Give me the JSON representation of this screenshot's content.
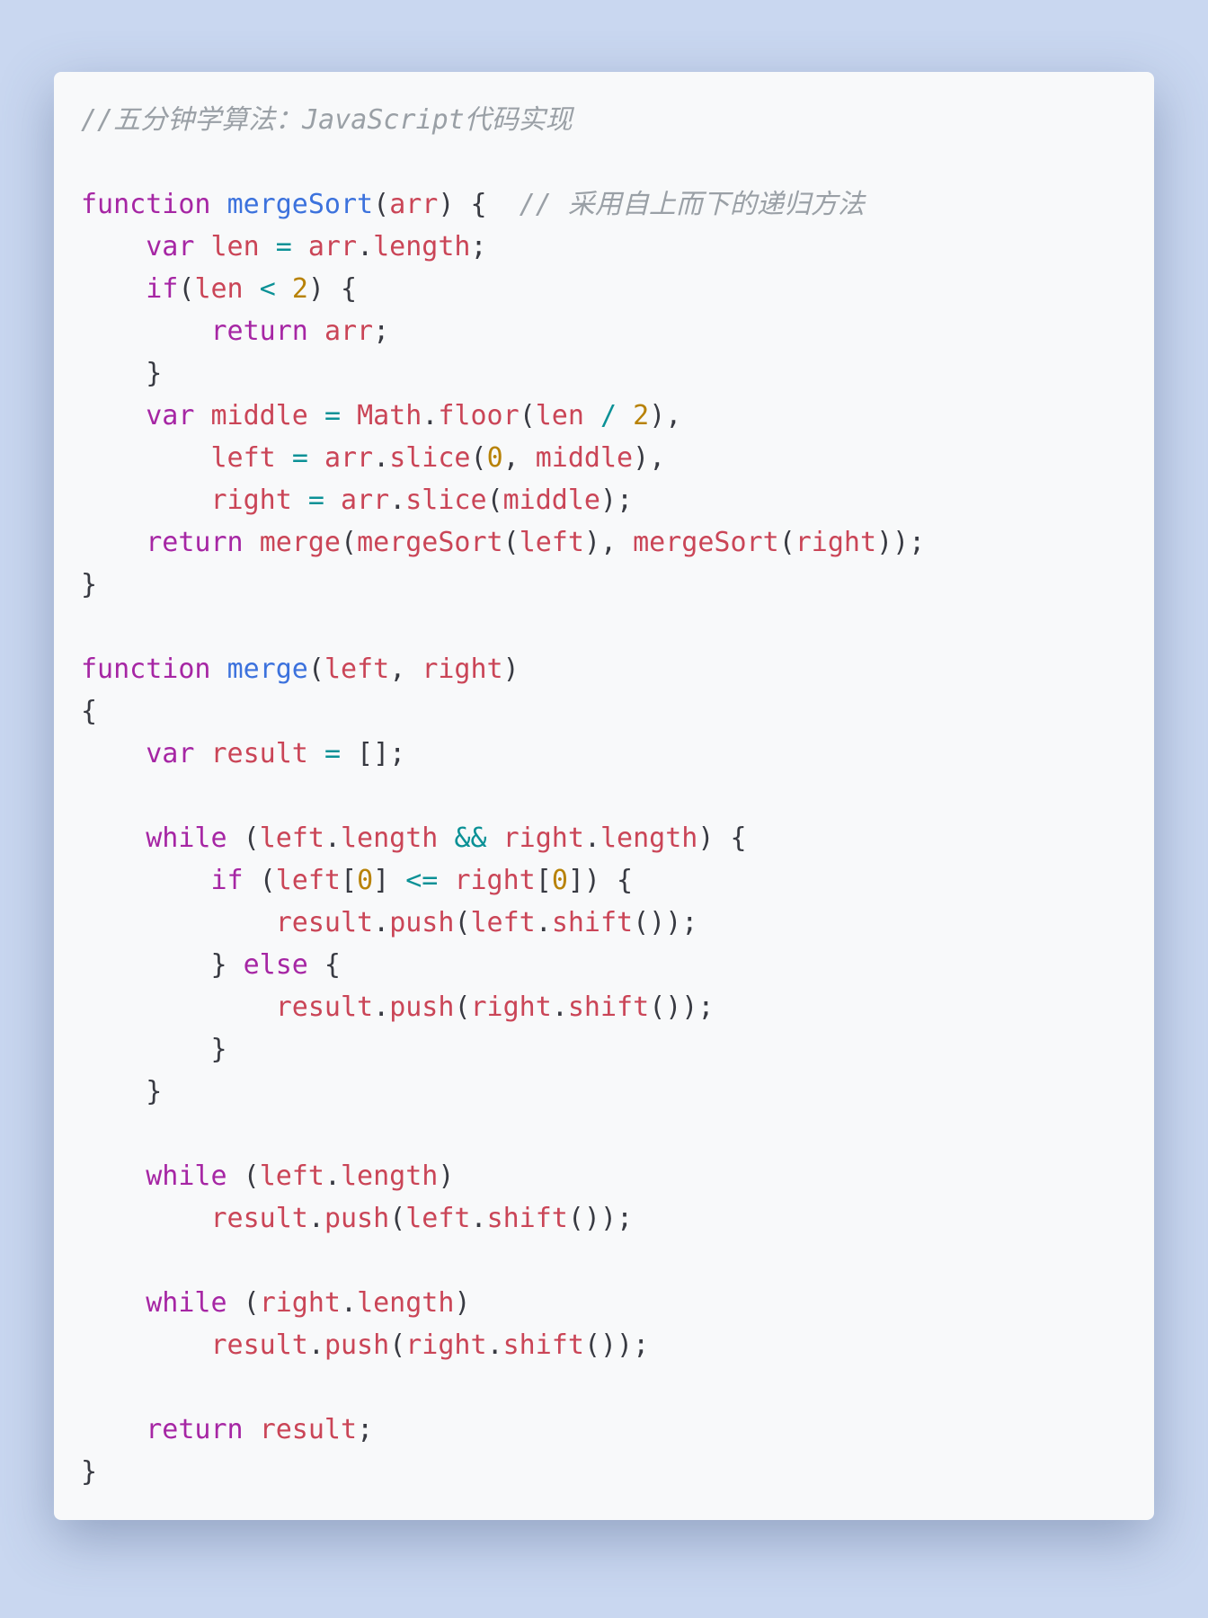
{
  "code": {
    "lines": [
      [
        {
          "t": "//五分钟学算法：JavaScript代码实现",
          "c": "tok-cm"
        }
      ],
      [
        {
          "t": "",
          "c": "tok-pl"
        }
      ],
      [
        {
          "t": "function",
          "c": "tok-kw"
        },
        {
          "t": " ",
          "c": "tok-pl"
        },
        {
          "t": "mergeSort",
          "c": "tok-fn"
        },
        {
          "t": "(",
          "c": "tok-pn"
        },
        {
          "t": "arr",
          "c": "tok-id"
        },
        {
          "t": ") {",
          "c": "tok-pn"
        },
        {
          "t": "  ",
          "c": "tok-pl"
        },
        {
          "t": "// 采用自上而下的递归方法",
          "c": "tok-cm"
        }
      ],
      [
        {
          "t": "    ",
          "c": "tok-pl"
        },
        {
          "t": "var",
          "c": "tok-kw"
        },
        {
          "t": " ",
          "c": "tok-pl"
        },
        {
          "t": "len",
          "c": "tok-id"
        },
        {
          "t": " ",
          "c": "tok-pl"
        },
        {
          "t": "=",
          "c": "tok-op"
        },
        {
          "t": " ",
          "c": "tok-pl"
        },
        {
          "t": "arr",
          "c": "tok-id"
        },
        {
          "t": ".",
          "c": "tok-pn"
        },
        {
          "t": "length",
          "c": "tok-id"
        },
        {
          "t": ";",
          "c": "tok-pn"
        }
      ],
      [
        {
          "t": "    ",
          "c": "tok-pl"
        },
        {
          "t": "if",
          "c": "tok-kw"
        },
        {
          "t": "(",
          "c": "tok-pn"
        },
        {
          "t": "len",
          "c": "tok-id"
        },
        {
          "t": " ",
          "c": "tok-pl"
        },
        {
          "t": "<",
          "c": "tok-op"
        },
        {
          "t": " ",
          "c": "tok-pl"
        },
        {
          "t": "2",
          "c": "tok-nm"
        },
        {
          "t": ") {",
          "c": "tok-pn"
        }
      ],
      [
        {
          "t": "        ",
          "c": "tok-pl"
        },
        {
          "t": "return",
          "c": "tok-kw"
        },
        {
          "t": " ",
          "c": "tok-pl"
        },
        {
          "t": "arr",
          "c": "tok-id"
        },
        {
          "t": ";",
          "c": "tok-pn"
        }
      ],
      [
        {
          "t": "    }",
          "c": "tok-pn"
        }
      ],
      [
        {
          "t": "    ",
          "c": "tok-pl"
        },
        {
          "t": "var",
          "c": "tok-kw"
        },
        {
          "t": " ",
          "c": "tok-pl"
        },
        {
          "t": "middle",
          "c": "tok-id"
        },
        {
          "t": " ",
          "c": "tok-pl"
        },
        {
          "t": "=",
          "c": "tok-op"
        },
        {
          "t": " ",
          "c": "tok-pl"
        },
        {
          "t": "Math",
          "c": "tok-id"
        },
        {
          "t": ".",
          "c": "tok-pn"
        },
        {
          "t": "floor",
          "c": "tok-id"
        },
        {
          "t": "(",
          "c": "tok-pn"
        },
        {
          "t": "len",
          "c": "tok-id"
        },
        {
          "t": " ",
          "c": "tok-pl"
        },
        {
          "t": "/",
          "c": "tok-op"
        },
        {
          "t": " ",
          "c": "tok-pl"
        },
        {
          "t": "2",
          "c": "tok-nm"
        },
        {
          "t": "),",
          "c": "tok-pn"
        }
      ],
      [
        {
          "t": "        ",
          "c": "tok-pl"
        },
        {
          "t": "left",
          "c": "tok-id"
        },
        {
          "t": " ",
          "c": "tok-pl"
        },
        {
          "t": "=",
          "c": "tok-op"
        },
        {
          "t": " ",
          "c": "tok-pl"
        },
        {
          "t": "arr",
          "c": "tok-id"
        },
        {
          "t": ".",
          "c": "tok-pn"
        },
        {
          "t": "slice",
          "c": "tok-id"
        },
        {
          "t": "(",
          "c": "tok-pn"
        },
        {
          "t": "0",
          "c": "tok-nm"
        },
        {
          "t": ", ",
          "c": "tok-pn"
        },
        {
          "t": "middle",
          "c": "tok-id"
        },
        {
          "t": "),",
          "c": "tok-pn"
        }
      ],
      [
        {
          "t": "        ",
          "c": "tok-pl"
        },
        {
          "t": "right",
          "c": "tok-id"
        },
        {
          "t": " ",
          "c": "tok-pl"
        },
        {
          "t": "=",
          "c": "tok-op"
        },
        {
          "t": " ",
          "c": "tok-pl"
        },
        {
          "t": "arr",
          "c": "tok-id"
        },
        {
          "t": ".",
          "c": "tok-pn"
        },
        {
          "t": "slice",
          "c": "tok-id"
        },
        {
          "t": "(",
          "c": "tok-pn"
        },
        {
          "t": "middle",
          "c": "tok-id"
        },
        {
          "t": ");",
          "c": "tok-pn"
        }
      ],
      [
        {
          "t": "    ",
          "c": "tok-pl"
        },
        {
          "t": "return",
          "c": "tok-kw"
        },
        {
          "t": " ",
          "c": "tok-pl"
        },
        {
          "t": "merge",
          "c": "tok-id"
        },
        {
          "t": "(",
          "c": "tok-pn"
        },
        {
          "t": "mergeSort",
          "c": "tok-id"
        },
        {
          "t": "(",
          "c": "tok-pn"
        },
        {
          "t": "left",
          "c": "tok-id"
        },
        {
          "t": "), ",
          "c": "tok-pn"
        },
        {
          "t": "mergeSort",
          "c": "tok-id"
        },
        {
          "t": "(",
          "c": "tok-pn"
        },
        {
          "t": "right",
          "c": "tok-id"
        },
        {
          "t": "));",
          "c": "tok-pn"
        }
      ],
      [
        {
          "t": "}",
          "c": "tok-pn"
        }
      ],
      [
        {
          "t": "",
          "c": "tok-pl"
        }
      ],
      [
        {
          "t": "function",
          "c": "tok-kw"
        },
        {
          "t": " ",
          "c": "tok-pl"
        },
        {
          "t": "merge",
          "c": "tok-fn"
        },
        {
          "t": "(",
          "c": "tok-pn"
        },
        {
          "t": "left",
          "c": "tok-id"
        },
        {
          "t": ", ",
          "c": "tok-pn"
        },
        {
          "t": "right",
          "c": "tok-id"
        },
        {
          "t": ")",
          "c": "tok-pn"
        }
      ],
      [
        {
          "t": "{",
          "c": "tok-pn"
        }
      ],
      [
        {
          "t": "    ",
          "c": "tok-pl"
        },
        {
          "t": "var",
          "c": "tok-kw"
        },
        {
          "t": " ",
          "c": "tok-pl"
        },
        {
          "t": "result",
          "c": "tok-id"
        },
        {
          "t": " ",
          "c": "tok-pl"
        },
        {
          "t": "=",
          "c": "tok-op"
        },
        {
          "t": " [];",
          "c": "tok-pn"
        }
      ],
      [
        {
          "t": "",
          "c": "tok-pl"
        }
      ],
      [
        {
          "t": "    ",
          "c": "tok-pl"
        },
        {
          "t": "while",
          "c": "tok-kw"
        },
        {
          "t": " (",
          "c": "tok-pn"
        },
        {
          "t": "left",
          "c": "tok-id"
        },
        {
          "t": ".",
          "c": "tok-pn"
        },
        {
          "t": "length",
          "c": "tok-id"
        },
        {
          "t": " ",
          "c": "tok-pl"
        },
        {
          "t": "&&",
          "c": "tok-op"
        },
        {
          "t": " ",
          "c": "tok-pl"
        },
        {
          "t": "right",
          "c": "tok-id"
        },
        {
          "t": ".",
          "c": "tok-pn"
        },
        {
          "t": "length",
          "c": "tok-id"
        },
        {
          "t": ") {",
          "c": "tok-pn"
        }
      ],
      [
        {
          "t": "        ",
          "c": "tok-pl"
        },
        {
          "t": "if",
          "c": "tok-kw"
        },
        {
          "t": " (",
          "c": "tok-pn"
        },
        {
          "t": "left",
          "c": "tok-id"
        },
        {
          "t": "[",
          "c": "tok-pn"
        },
        {
          "t": "0",
          "c": "tok-nm"
        },
        {
          "t": "] ",
          "c": "tok-pn"
        },
        {
          "t": "<=",
          "c": "tok-op"
        },
        {
          "t": " ",
          "c": "tok-pl"
        },
        {
          "t": "right",
          "c": "tok-id"
        },
        {
          "t": "[",
          "c": "tok-pn"
        },
        {
          "t": "0",
          "c": "tok-nm"
        },
        {
          "t": "]) {",
          "c": "tok-pn"
        }
      ],
      [
        {
          "t": "            ",
          "c": "tok-pl"
        },
        {
          "t": "result",
          "c": "tok-id"
        },
        {
          "t": ".",
          "c": "tok-pn"
        },
        {
          "t": "push",
          "c": "tok-id"
        },
        {
          "t": "(",
          "c": "tok-pn"
        },
        {
          "t": "left",
          "c": "tok-id"
        },
        {
          "t": ".",
          "c": "tok-pn"
        },
        {
          "t": "shift",
          "c": "tok-id"
        },
        {
          "t": "());",
          "c": "tok-pn"
        }
      ],
      [
        {
          "t": "        } ",
          "c": "tok-pn"
        },
        {
          "t": "else",
          "c": "tok-kw"
        },
        {
          "t": " {",
          "c": "tok-pn"
        }
      ],
      [
        {
          "t": "            ",
          "c": "tok-pl"
        },
        {
          "t": "result",
          "c": "tok-id"
        },
        {
          "t": ".",
          "c": "tok-pn"
        },
        {
          "t": "push",
          "c": "tok-id"
        },
        {
          "t": "(",
          "c": "tok-pn"
        },
        {
          "t": "right",
          "c": "tok-id"
        },
        {
          "t": ".",
          "c": "tok-pn"
        },
        {
          "t": "shift",
          "c": "tok-id"
        },
        {
          "t": "());",
          "c": "tok-pn"
        }
      ],
      [
        {
          "t": "        }",
          "c": "tok-pn"
        }
      ],
      [
        {
          "t": "    }",
          "c": "tok-pn"
        }
      ],
      [
        {
          "t": "",
          "c": "tok-pl"
        }
      ],
      [
        {
          "t": "    ",
          "c": "tok-pl"
        },
        {
          "t": "while",
          "c": "tok-kw"
        },
        {
          "t": " (",
          "c": "tok-pn"
        },
        {
          "t": "left",
          "c": "tok-id"
        },
        {
          "t": ".",
          "c": "tok-pn"
        },
        {
          "t": "length",
          "c": "tok-id"
        },
        {
          "t": ")",
          "c": "tok-pn"
        }
      ],
      [
        {
          "t": "        ",
          "c": "tok-pl"
        },
        {
          "t": "result",
          "c": "tok-id"
        },
        {
          "t": ".",
          "c": "tok-pn"
        },
        {
          "t": "push",
          "c": "tok-id"
        },
        {
          "t": "(",
          "c": "tok-pn"
        },
        {
          "t": "left",
          "c": "tok-id"
        },
        {
          "t": ".",
          "c": "tok-pn"
        },
        {
          "t": "shift",
          "c": "tok-id"
        },
        {
          "t": "());",
          "c": "tok-pn"
        }
      ],
      [
        {
          "t": "",
          "c": "tok-pl"
        }
      ],
      [
        {
          "t": "    ",
          "c": "tok-pl"
        },
        {
          "t": "while",
          "c": "tok-kw"
        },
        {
          "t": " (",
          "c": "tok-pn"
        },
        {
          "t": "right",
          "c": "tok-id"
        },
        {
          "t": ".",
          "c": "tok-pn"
        },
        {
          "t": "length",
          "c": "tok-id"
        },
        {
          "t": ")",
          "c": "tok-pn"
        }
      ],
      [
        {
          "t": "        ",
          "c": "tok-pl"
        },
        {
          "t": "result",
          "c": "tok-id"
        },
        {
          "t": ".",
          "c": "tok-pn"
        },
        {
          "t": "push",
          "c": "tok-id"
        },
        {
          "t": "(",
          "c": "tok-pn"
        },
        {
          "t": "right",
          "c": "tok-id"
        },
        {
          "t": ".",
          "c": "tok-pn"
        },
        {
          "t": "shift",
          "c": "tok-id"
        },
        {
          "t": "());",
          "c": "tok-pn"
        }
      ],
      [
        {
          "t": "",
          "c": "tok-pl"
        }
      ],
      [
        {
          "t": "    ",
          "c": "tok-pl"
        },
        {
          "t": "return",
          "c": "tok-kw"
        },
        {
          "t": " ",
          "c": "tok-pl"
        },
        {
          "t": "result",
          "c": "tok-id"
        },
        {
          "t": ";",
          "c": "tok-pn"
        }
      ],
      [
        {
          "t": "}",
          "c": "tok-pn"
        }
      ]
    ]
  }
}
